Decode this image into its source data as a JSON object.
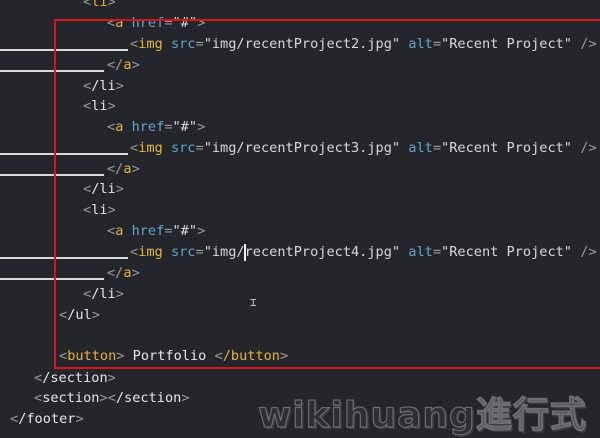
{
  "code": {
    "li_open": "li",
    "li_close": "/li",
    "a_tag": "a",
    "a_close": "/a",
    "href_attr": "href",
    "href_val": "\"#\"",
    "img_tag": "img",
    "src_attr": "src",
    "alt_attr": "alt",
    "alt_val": "\"Recent Project\"",
    "srcs": [
      "\"img/recentProject2.jpg\"",
      "\"img/recentProject3.jpg\"",
      "\"img/recentProject4.jpg\""
    ],
    "ul_close": "/ul",
    "button_tag": "button",
    "button_close": "/button",
    "button_text": " Portfolio ",
    "section_close": "/section",
    "section_open": "section",
    "footer_close": "/footer"
  },
  "watermark": "wikihuang進行式",
  "colors": {
    "background": "#25262b",
    "tag": "#e3b443",
    "attr": "#5fa8cf",
    "selection_box": "#d8141b"
  }
}
